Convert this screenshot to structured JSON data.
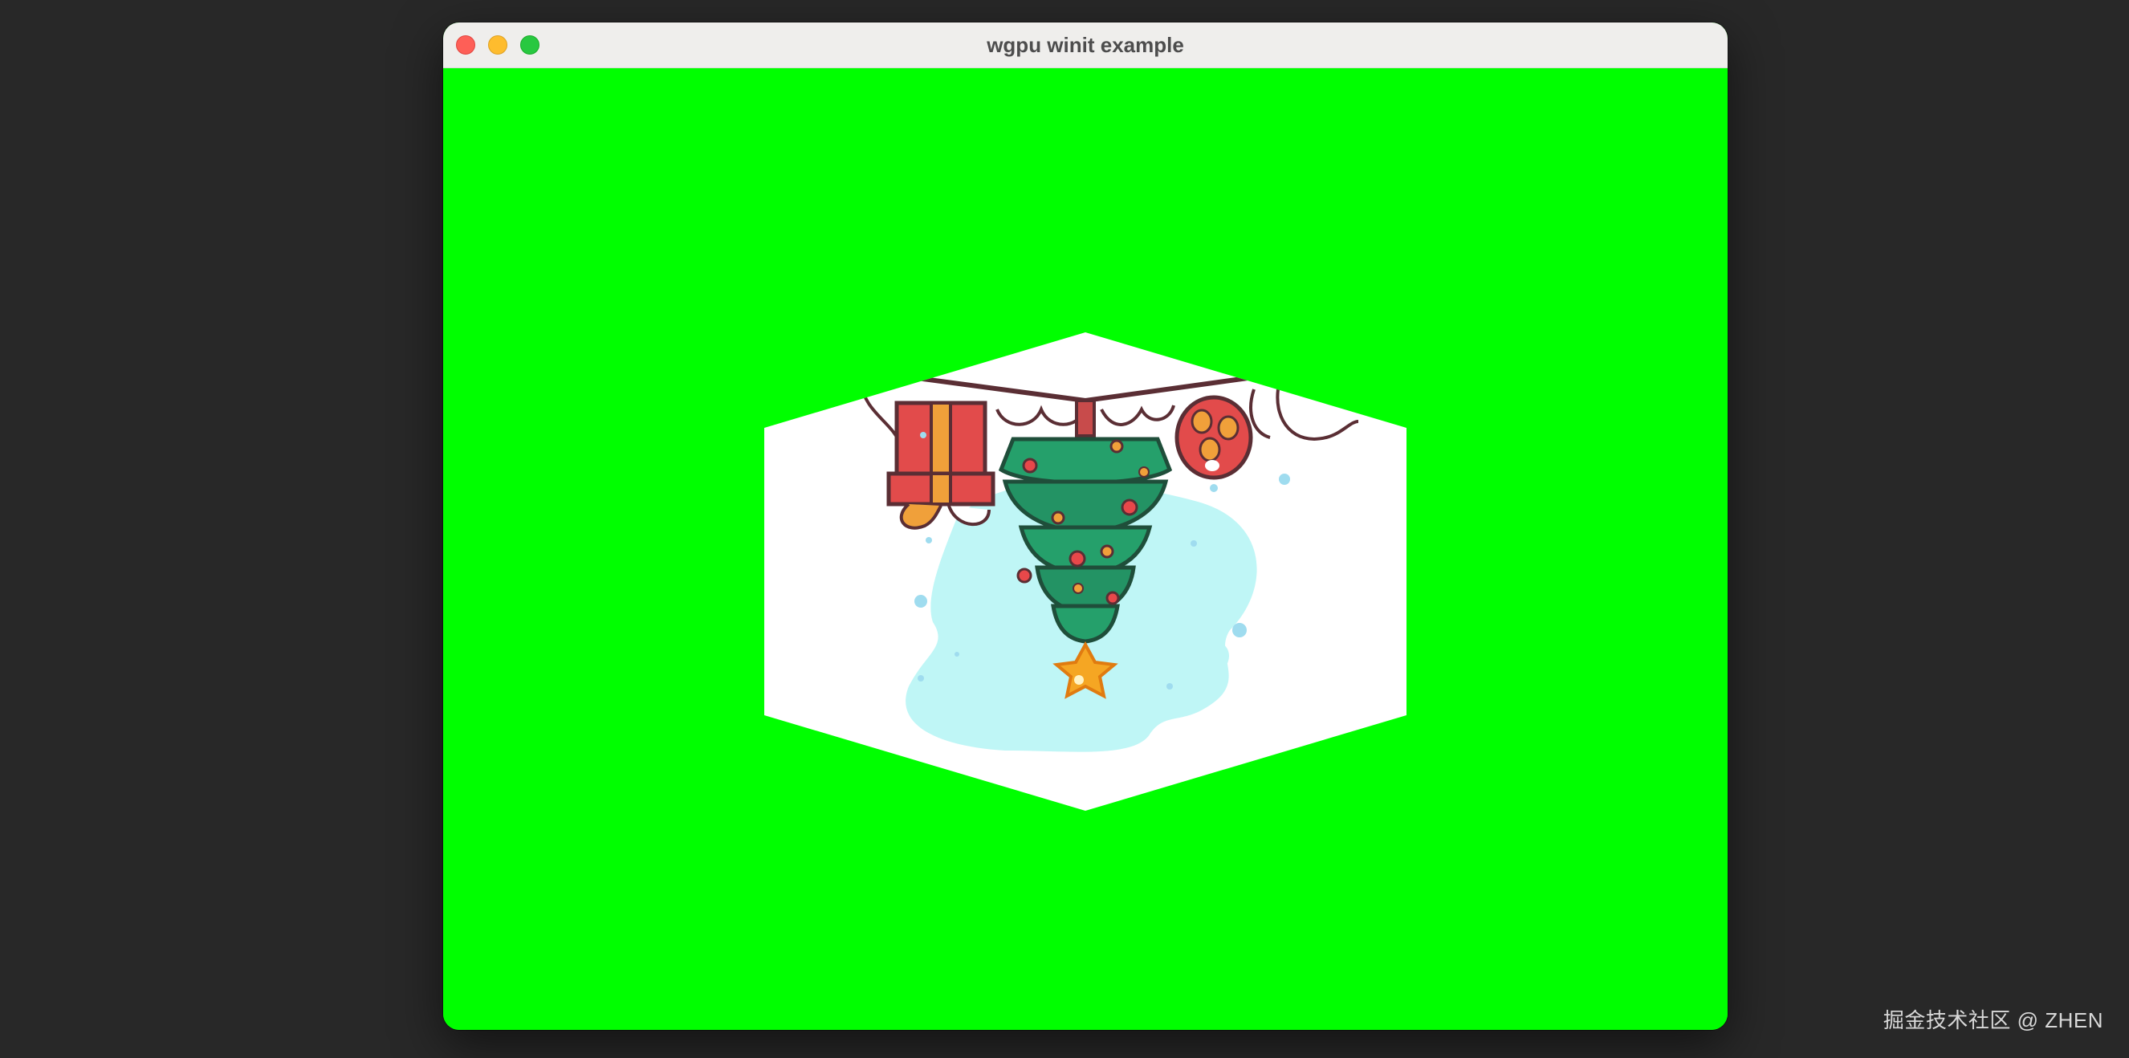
{
  "window": {
    "title": "wgpu winit example"
  },
  "watermark": {
    "text": "掘金技术社区 @ ZHEN"
  },
  "colors": {
    "clear_color": "#00ff00",
    "desktop": "#282828",
    "titlebar": "#efeeec"
  },
  "icons": {
    "close": "close-icon",
    "minimize": "minimize-icon",
    "maximize": "maximize-icon"
  }
}
